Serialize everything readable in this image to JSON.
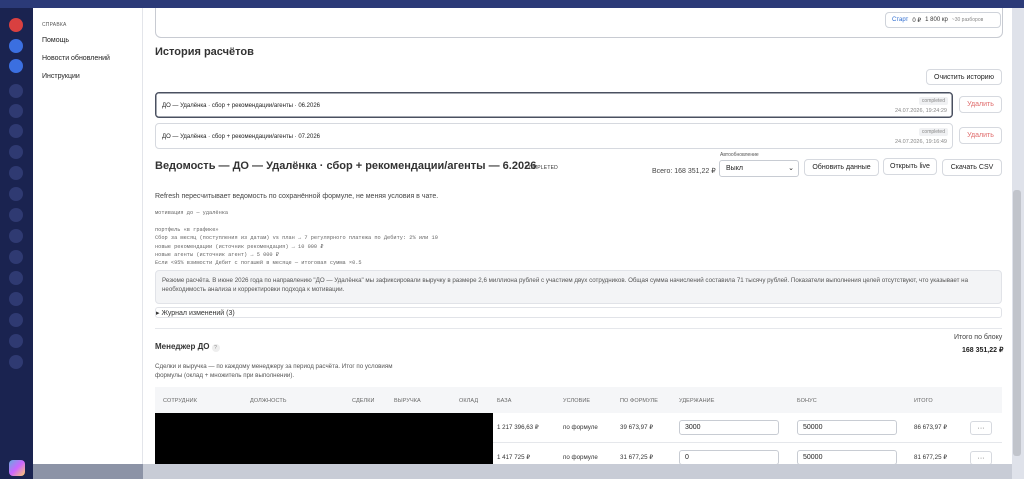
{
  "help": {
    "heading": "СПРАВКА",
    "links": [
      "Помощь",
      "Новости обновлений",
      "Инструкции"
    ]
  },
  "plan": {
    "name": "Старт",
    "balance": "0 ₽",
    "price": "1 800 кр",
    "runs": "~30 разборов"
  },
  "history": {
    "title": "История расчётов",
    "clear_label": "Очистить историю",
    "delete_label": "Удалить",
    "items": [
      {
        "title": "ДО — Удалёнка · сбор + рекомендации/агенты · 06.2026",
        "status": "completed",
        "date": "24.07.2026, 19:24:29"
      },
      {
        "title": "ДО — Удалёнка · сбор + рекомендации/агенты · 07.2026",
        "status": "completed",
        "date": "24.07.2026, 19:16:49"
      }
    ]
  },
  "ledger": {
    "title": "Ведомость — ДО — Удалёнка · сбор + рекомендации/агенты — 6.2026",
    "status": "COMPLETED",
    "total": "Всего: 168 351,22 ₽",
    "auto_label": "Автообновление",
    "auto_value": "Выкл",
    "refresh_label": "Обновить данные",
    "open_live_label": "Открыть live",
    "csv_label": "Скачать CSV",
    "refresh_note": "Refresh пересчитывает ведомость по сохранённой формуле, не меняя условия в чате.",
    "formula_lines": [
      "мотивация до — удалёнка",
      "",
      "",
      "портфель «в графике»",
      "Сбор за месяц (поступления из датам) vs план → 7 регулярного платежа по Дебиту: 2% или 10",
      "новые рекомендации (источник рекомендация) → 10 000 ₽",
      "новые агенты (источник агент) → 5 000 ₽",
      "Если <95% взимости Дебит с погашей в месяце — итоговая сумма ×0.5"
    ],
    "summary": "Резюме расчёта. В июне 2026 года по направлению \"ДО — Удалёнка\" мы зафиксировали выручку в размере 2,6 миллиона рублей с участием двух сотрудников. Общая сумма начислений составила 71 тысячу рублей. Показатели выполнения целей отсутствуют, что указывает на необходимость анализа и корректировки подхода к мотивации.",
    "journal": "▸ Журнал изменений (3)"
  },
  "block": {
    "title": "Менеджер ДО",
    "total_label": "Итого по блоку",
    "total_value": "168 351,22 ₽",
    "description": "Сделки и выручка — по каждому менеджеру за период расчёта. Итог по условиям формулы (оклад + множитель при выполнении).",
    "columns": [
      "СОТРУДНИК",
      "ДОЛЖНОСТЬ",
      "СДЕЛКИ",
      "ВЫРУЧКА",
      "ОКЛАД",
      "БАЗА",
      "УСЛОВИЕ",
      "ПО ФОРМУЛЕ",
      "УДЕРЖАНИЕ",
      "БОНУС",
      "ИТОГО"
    ],
    "rows": [
      {
        "base": "1 217 396,63 ₽",
        "condition": "по формуле",
        "by_formula": "39 673,97 ₽",
        "hold": "3000",
        "bonus": "50000",
        "total": "86 673,97 ₽",
        "action": "···"
      },
      {
        "base": "1 417 725 ₽",
        "condition": "по формуле",
        "by_formula": "31 677,25 ₽",
        "hold": "0",
        "bonus": "50000",
        "total": "81 677,25 ₽",
        "action": "···"
      }
    ]
  }
}
